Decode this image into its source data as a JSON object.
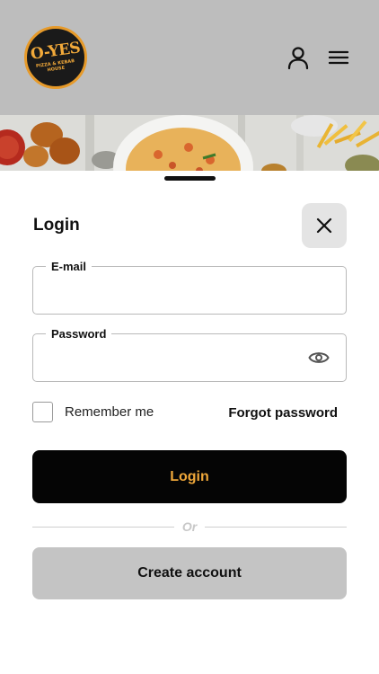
{
  "header": {
    "logo": {
      "main_text": "O-YES",
      "sub_text": "PIZZA & KEBAB HOUSE"
    },
    "user_icon": "user-icon",
    "menu_icon": "hamburger-menu-icon"
  },
  "banner": {
    "image": "food-banner"
  },
  "login_sheet": {
    "title": "Login",
    "close_icon": "close-icon",
    "email": {
      "label": "E-mail",
      "value": "",
      "placeholder": ""
    },
    "password": {
      "label": "Password",
      "value": "",
      "placeholder": "",
      "toggle_icon": "eye-icon"
    },
    "remember_me": {
      "label": "Remember me",
      "checked": false
    },
    "forgot_password": "Forgot password",
    "login_button": "Login",
    "divider_text": "Or",
    "create_account_button": "Create account"
  },
  "colors": {
    "header_bg": "#bdbdbd",
    "accent": "#f0a83a",
    "primary_button": "#050505",
    "secondary_button": "#c4c4c4",
    "close_button_bg": "#e4e4e4"
  }
}
